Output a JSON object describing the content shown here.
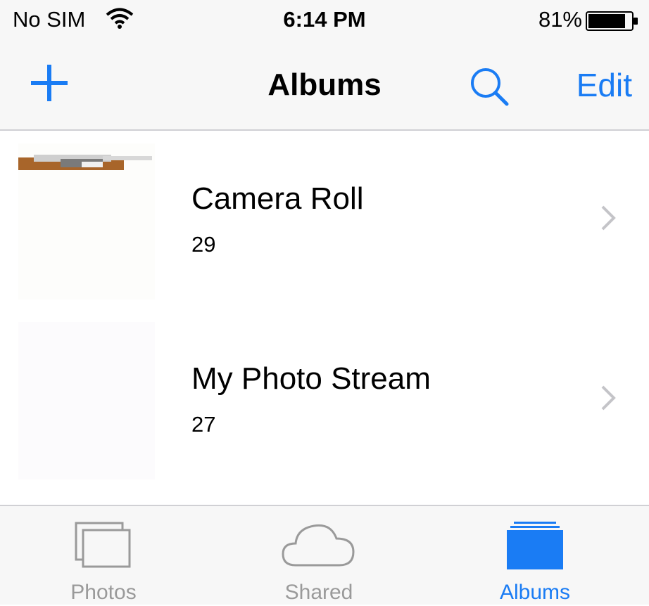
{
  "status": {
    "carrier": "No SIM",
    "time": "6:14 PM",
    "battery": "81%"
  },
  "nav": {
    "title": "Albums",
    "edit": "Edit"
  },
  "albums": [
    {
      "title": "Camera Roll",
      "count": "29"
    },
    {
      "title": "My Photo Stream",
      "count": "27"
    }
  ],
  "tabs": [
    {
      "label": "Photos",
      "icon": "photos-icon"
    },
    {
      "label": "Shared",
      "icon": "cloud-icon"
    },
    {
      "label": "Albums",
      "icon": "albums-icon",
      "active": true
    }
  ],
  "colors": {
    "accent": "#1a7cf4",
    "inactive": "#9a9a9a",
    "bar": "#f7f7f7"
  }
}
